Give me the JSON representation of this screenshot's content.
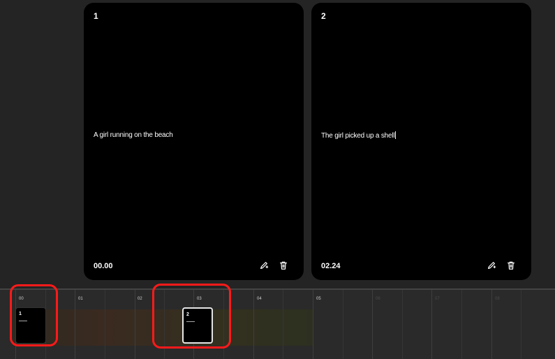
{
  "cards": [
    {
      "number": "1",
      "prompt": "A girl running on the beach",
      "time": "00.00",
      "edit_icon": "pencil-sparkle-icon",
      "delete_icon": "trash-icon"
    },
    {
      "number": "2",
      "prompt": "The girl picked up a shell",
      "time": "02.24",
      "edit_icon": "pencil-sparkle-icon",
      "delete_icon": "trash-icon"
    }
  ],
  "timeline": {
    "tick_labels": [
      "00",
      "01",
      "02",
      "03",
      "04",
      "05",
      "06",
      "07",
      "08"
    ],
    "clips": [
      {
        "number": "1"
      },
      {
        "number": "2"
      }
    ]
  },
  "colors": {
    "background": "#242424",
    "card": "#000000",
    "highlight": "#ff1a1a",
    "selected_clip_border": "#e6e6e6"
  }
}
